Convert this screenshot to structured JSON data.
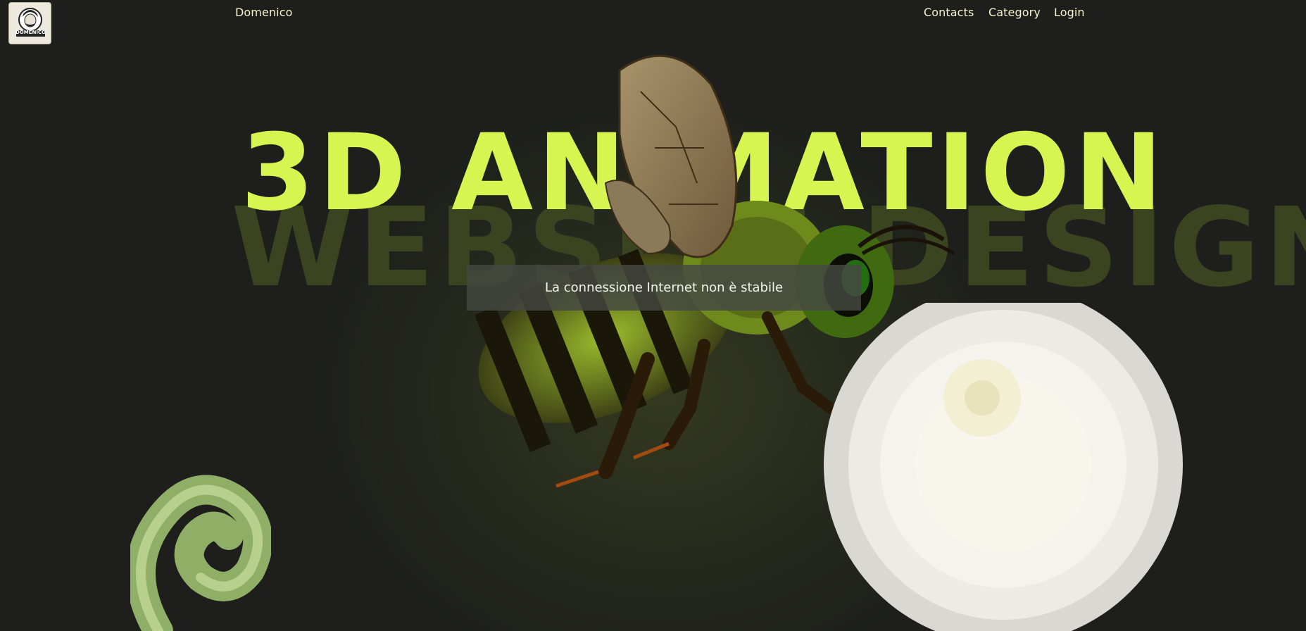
{
  "header": {
    "logo_text": "DOMENICO",
    "brand": "Domenico",
    "nav": [
      "Contacts",
      "Category",
      "Login"
    ]
  },
  "hero": {
    "line1": "3D ANIMATION",
    "line2": "WEBSITE DESIGN"
  },
  "toast": {
    "message": "La connessione Internet non è stabile"
  },
  "colors": {
    "background": "#1e1f1c",
    "accent": "#d6f551",
    "secondary_text": "#3a4420"
  }
}
